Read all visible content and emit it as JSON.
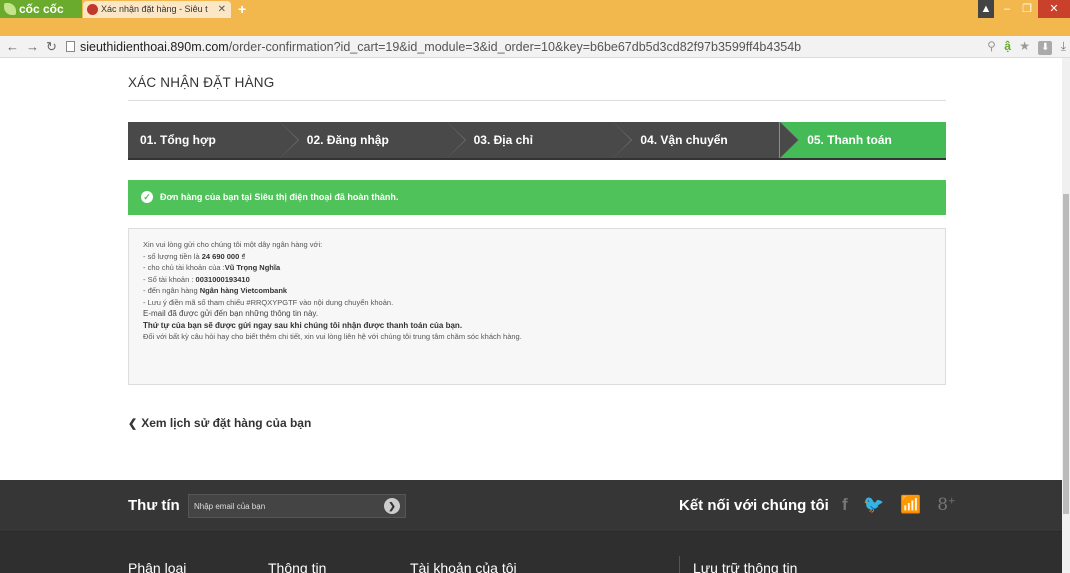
{
  "browser": {
    "logo": "cốc cốc",
    "tab_title": "Xác nhận đặt hàng - Siêu t",
    "new_tab": "+",
    "url_host": "sieuthidienthoai.890m.com",
    "url_path": "/order-confirmation?id_cart=19&id_module=3&id_order=10&key=b6be67db5d3cd82f97b3599ff4b4354b"
  },
  "page": {
    "title": "XÁC NHẬN ĐẶT HÀNG",
    "steps": [
      {
        "label": "01. Tổng hợp"
      },
      {
        "label": "02. Đăng nhập"
      },
      {
        "label": "03. Địa chỉ"
      },
      {
        "label": "04. Vận chuyển"
      },
      {
        "label": "05. Thanh toán"
      }
    ],
    "active_step": 5,
    "success_message": "Đơn hàng của bạn tại Siêu thị điện thoại đã hoàn thành.",
    "info": {
      "intro": "Xin vui lòng gửi cho chúng tôi một dây ngân hàng với:",
      "amount_prefix": "- số lượng tiền là ",
      "amount": "24 690 000 ₫",
      "holder_prefix": "- cho chủ tài khoản của :",
      "holder": "Vũ Trọng Nghĩa",
      "account_prefix": "- Số tài khoản : ",
      "account": "0031000193410",
      "bank_prefix": "- đến ngân hàng ",
      "bank": "Ngân hàng Vietcombank",
      "reference": "- Lưu ý điền mã số tham chiếu #RRQXYPGTF vào nội dung chuyển khoản.",
      "email_note": "E-mail đã được gửi đến bạn những thông tin này.",
      "ship_note": "Thứ tự của bạn sẽ được gửi ngay sau khi chúng tôi nhận được thanh toán của bạn.",
      "contact_note": "Đối với bất kỳ câu hỏi hay cho biết thêm chi tiết, xin vui lòng liên hệ với chúng tôi trung tâm chăm sóc khách hàng."
    },
    "history_link": "Xem lịch sử đặt hàng của bạn"
  },
  "footer": {
    "newsletter_label": "Thư tín",
    "newsletter_placeholder": "Nhập email của bạn",
    "connect_label": "Kết nối với chúng tôi",
    "columns": [
      "Phân loại",
      "Thông tin",
      "Tài khoản của tôi",
      "Lưu trữ thông tin"
    ]
  },
  "colors": {
    "step_active": "#44bb56",
    "step_default": "#494949",
    "success": "#4fc35a",
    "footer": "#333333"
  }
}
